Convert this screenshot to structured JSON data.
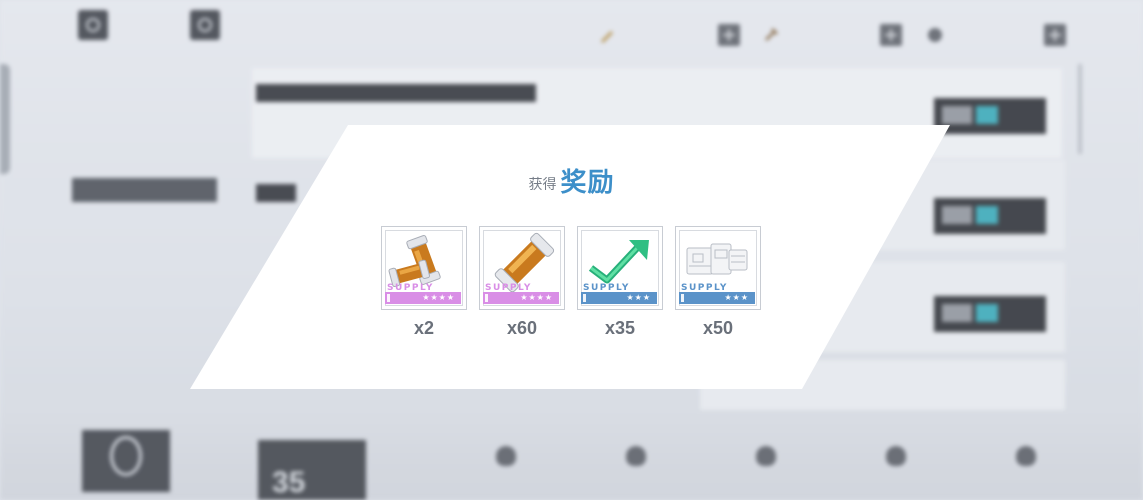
{
  "popup": {
    "title_prefix": "获得",
    "title_main": "奖励"
  },
  "rewards": [
    {
      "icon": "battery-capsule-pair-icon",
      "supply_text": "SUPPLY",
      "stars": "★★★★",
      "rarity_color": "#d98ee6",
      "quantity": "x2"
    },
    {
      "icon": "battery-capsule-icon",
      "supply_text": "SUPPLY",
      "stars": "★★★★",
      "rarity_color": "#d98ee6",
      "quantity": "x60"
    },
    {
      "icon": "green-upgrade-arrow-icon",
      "supply_text": "SUPPLY",
      "stars": "★★★",
      "rarity_color": "#5b93c9",
      "quantity": "x35"
    },
    {
      "icon": "gray-blueprint-part-icon",
      "supply_text": "SUPPLY",
      "stars": "★★★",
      "rarity_color": "#5b93c9",
      "quantity": "x50"
    }
  ],
  "background": {
    "level_value": "35"
  },
  "colors": {
    "accent_blue": "#3d8fc9",
    "popup_bg": "#ffffff",
    "rarity_purple": "#d98ee6",
    "rarity_blue": "#5b93c9"
  }
}
